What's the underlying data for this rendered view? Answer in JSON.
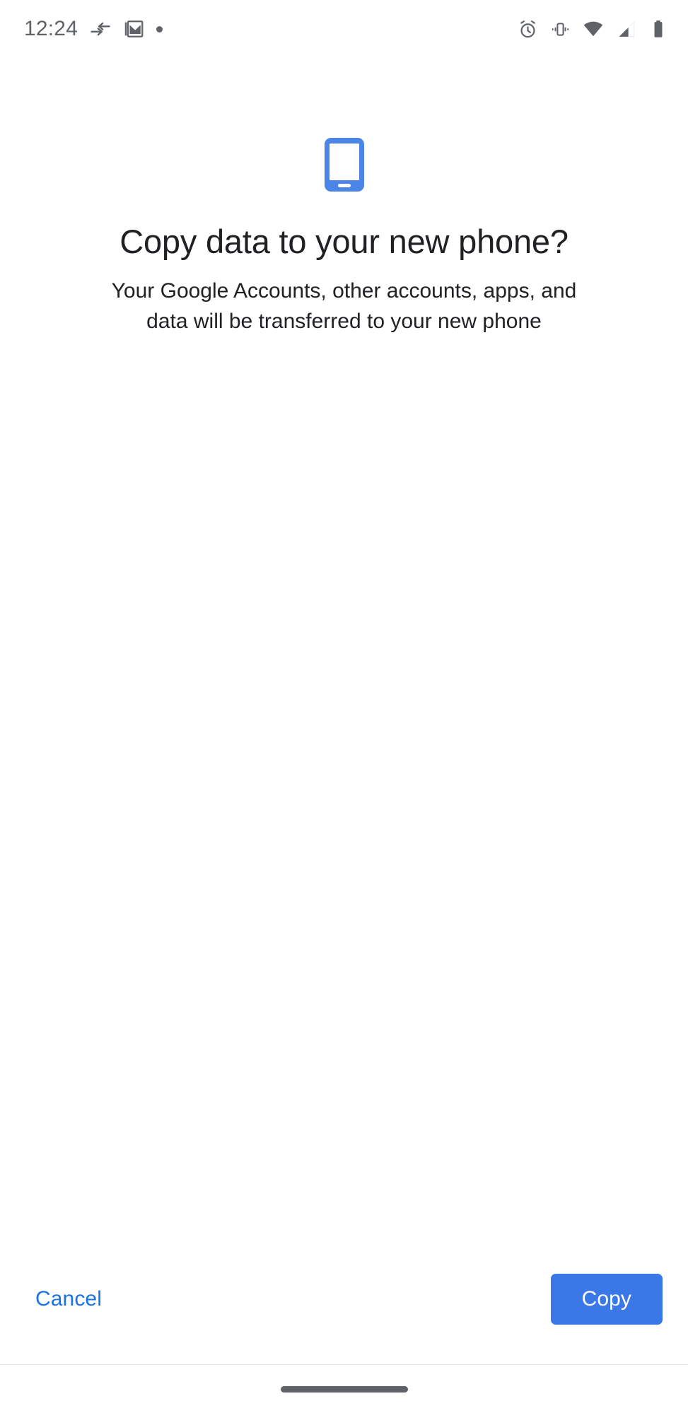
{
  "status_bar": {
    "time": "12:24",
    "left_icons": [
      {
        "name": "data-transfer-arrows-icon"
      },
      {
        "name": "gmail-icon"
      },
      {
        "name": "notification-dot-icon"
      }
    ],
    "right_icons": [
      {
        "name": "alarm-clock-icon"
      },
      {
        "name": "vibrate-icon"
      },
      {
        "name": "wifi-icon"
      },
      {
        "name": "cellular-signal-icon"
      },
      {
        "name": "battery-icon"
      }
    ]
  },
  "main": {
    "hero_icon": "smartphone-icon",
    "headline": "Copy data to your new phone?",
    "subtitle": "Your Google Accounts, other accounts, apps, and data will be transferred to your new phone"
  },
  "actions": {
    "cancel_label": "Cancel",
    "copy_label": "Copy"
  },
  "nav_bar": {
    "home_indicator": "home-gesture-pill"
  },
  "colors": {
    "accent_blue": "#3b78e7",
    "link_blue": "#1a73e8",
    "icon_grey": "#5f6368",
    "text_primary": "#202124",
    "background": "#ffffff"
  }
}
